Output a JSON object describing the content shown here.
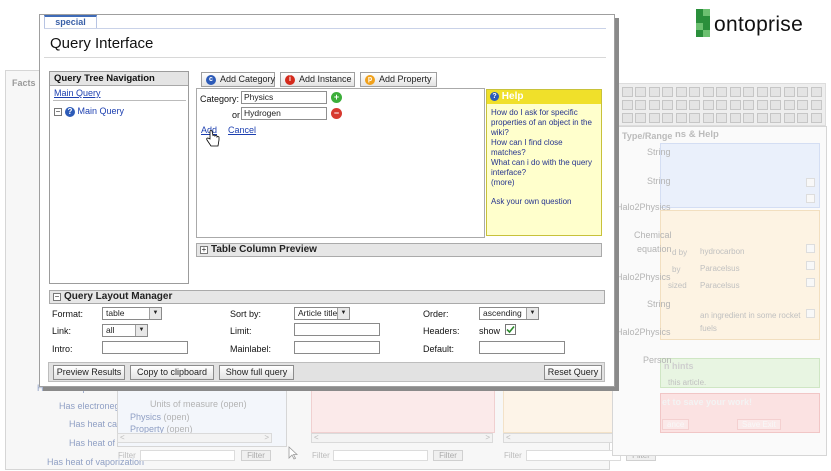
{
  "background": {
    "facts_label": "Facts",
    "left_rows": [
      "Has electrophore",
      "Has electronegativity",
      "Has heat capacity",
      "Has heat of fusion",
      "Has heat of vaporization"
    ],
    "tree_rows": [
      "Units of measure",
      "Physics",
      "Property"
    ],
    "tree_tags": [
      "(open)",
      "(open)",
      "(open)"
    ],
    "filter_label": "Filter",
    "filter_button": "Filter",
    "right": {
      "header": "Type/Range",
      "header2": "ns & Help",
      "types": [
        "String",
        "String",
        "Halo2Physics",
        "Chemical",
        "equation",
        "Halo2Physics",
        "String",
        "Halo2Physics",
        "Person"
      ],
      "values": [
        "hydrocarbon",
        "Paracelsus",
        "Paracelsus",
        "an ingredient in some rocket",
        "fuels"
      ],
      "prefixes": [
        "d by",
        "by",
        "sized"
      ],
      "hints": "n hints",
      "this_article": "this article.",
      "save_warning": "et to save your work!",
      "buttons": [
        "ance",
        "Save Exit"
      ]
    }
  },
  "logo": {
    "text": "ontoprise"
  },
  "dialog": {
    "tab": "special",
    "title": "Query Interface",
    "tree_nav": {
      "title": "Query Tree Navigation",
      "link": "Main Query",
      "root": "Main Query"
    },
    "toolbar": {
      "add_category": "Add Category",
      "add_instance": "Add Instance",
      "add_property": "Add Property"
    },
    "category": {
      "label": "Category:",
      "value1": "Physics",
      "or_label": "or",
      "value2": "Hydrogen",
      "add": "Add",
      "cancel": "Cancel"
    },
    "help": {
      "title": "Help",
      "items": [
        "How do I ask for specific properties of an object in the wiki?",
        "How can I find close matches?",
        "What can i do with the query interface?",
        "(more)"
      ],
      "ask": "Ask your own question"
    },
    "table_preview": "Table Column Preview",
    "layout_manager": {
      "title": "Query Layout Manager",
      "format_label": "Format:",
      "format_value": "table",
      "link_label": "Link:",
      "link_value": "all",
      "intro_label": "Intro:",
      "sort_label": "Sort by:",
      "sort_value": "Article title",
      "limit_label": "Limit:",
      "mainlabel_label": "Mainlabel:",
      "order_label": "Order:",
      "order_value": "ascending",
      "headers_label": "Headers:",
      "headers_value": "show",
      "default_label": "Default:"
    },
    "buttons": {
      "preview": "Preview Results",
      "copy": "Copy to clipboard",
      "full": "Show full query",
      "reset": "Reset Query"
    }
  }
}
